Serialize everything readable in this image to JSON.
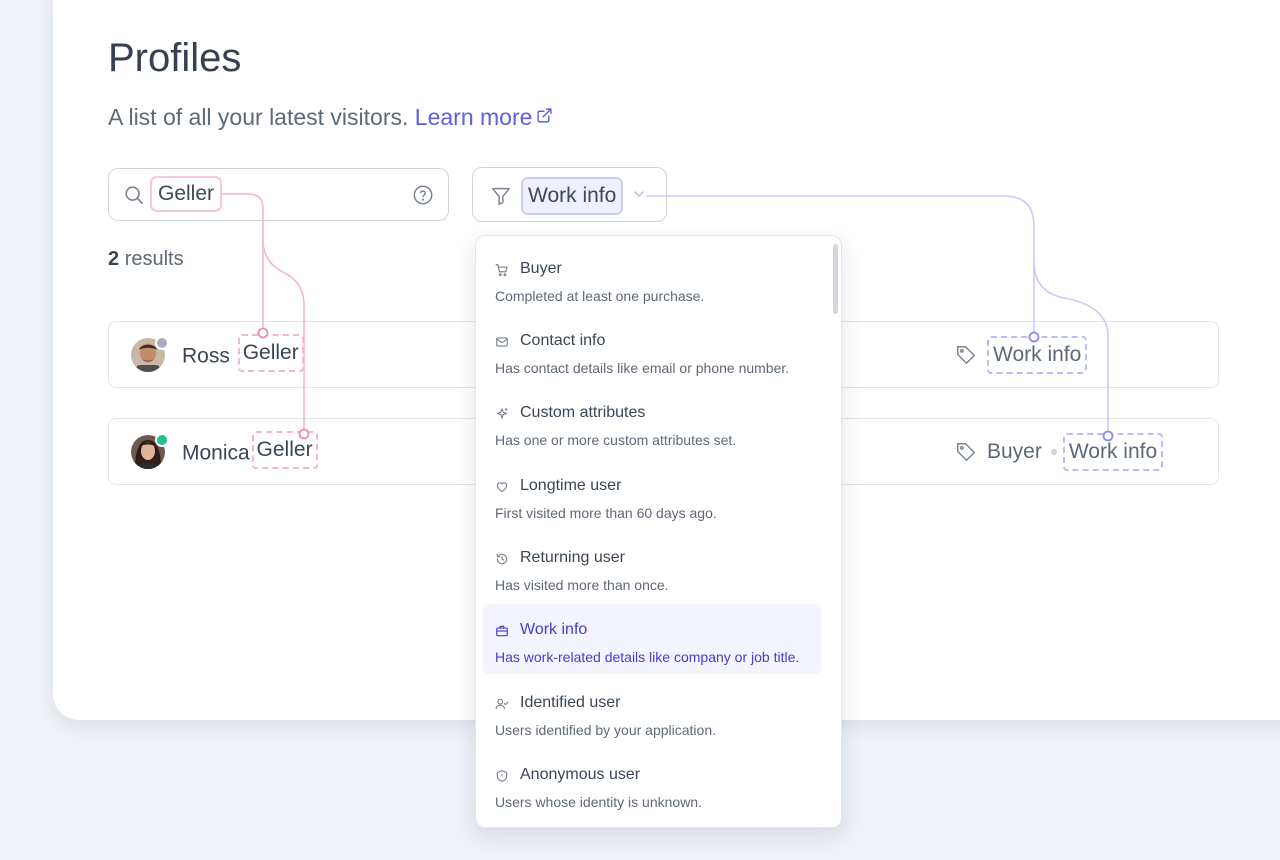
{
  "page": {
    "title": "Profiles",
    "subtitle": "A list of all your latest visitors.",
    "learn_more": "Learn more"
  },
  "search": {
    "value": "Geller",
    "icon": "search-icon",
    "help_icon": "question-circle-icon"
  },
  "filter": {
    "value": "Work info",
    "icon": "funnel-icon"
  },
  "results": {
    "count": "2",
    "label": "results"
  },
  "profiles": [
    {
      "first": "Ross",
      "last": "Geller",
      "status_color": "#a9aebb",
      "tags": [
        "Work info"
      ]
    },
    {
      "first": "Monica",
      "last": "Geller",
      "status_color": "#22c38e",
      "tags": [
        "Buyer",
        "Work info"
      ]
    }
  ],
  "dropdown": {
    "options": [
      {
        "label": "Buyer",
        "desc": "Completed at least one purchase.",
        "icon": "cart-icon"
      },
      {
        "label": "Contact info",
        "desc": "Has contact details like email or phone number.",
        "icon": "mail-icon"
      },
      {
        "label": "Custom attributes",
        "desc": "Has one or more custom attributes set.",
        "icon": "sparkle-icon"
      },
      {
        "label": "Longtime user",
        "desc": "First visited more than 60 days ago.",
        "icon": "heart-icon"
      },
      {
        "label": "Returning user",
        "desc": "Has visited more than once.",
        "icon": "history-icon"
      },
      {
        "label": "Work info",
        "desc": "Has work-related details like company or job title.",
        "icon": "briefcase-icon",
        "selected": true
      },
      {
        "label": "Identified user",
        "desc": "Users identified by your application.",
        "icon": "user-check-icon"
      },
      {
        "label": "Anonymous user",
        "desc": "Users whose identity is unknown.",
        "icon": "shield-icon"
      }
    ]
  },
  "colors": {
    "accent": "#5b5fe0",
    "pink": "#f5a9c8",
    "purple": "#b9bcf5"
  }
}
